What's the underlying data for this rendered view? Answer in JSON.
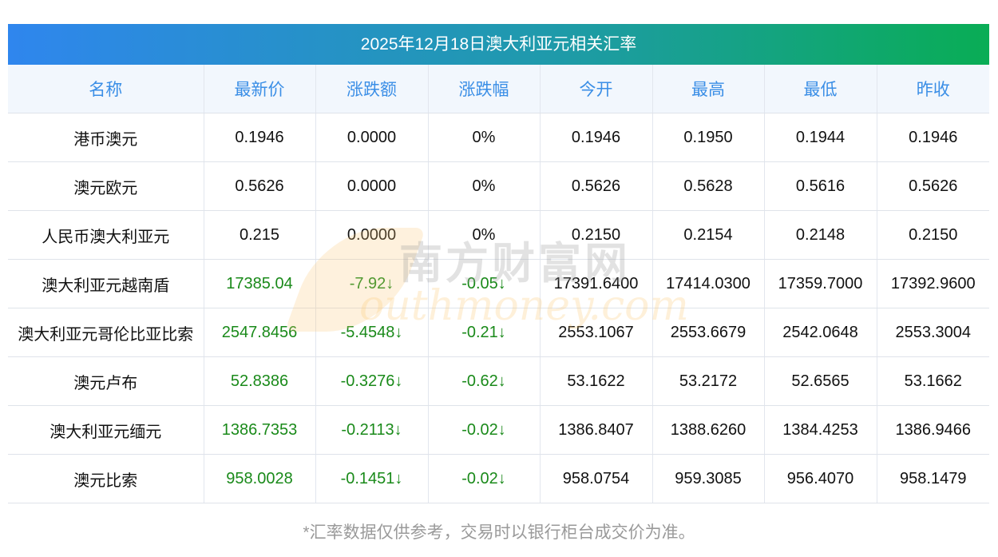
{
  "title": "2025年12月18日澳大利亚元相关汇率",
  "columns": [
    "名称",
    "最新价",
    "涨跌额",
    "涨跌幅",
    "今开",
    "最高",
    "最低",
    "昨收"
  ],
  "rows": [
    {
      "name": "港币澳元",
      "latest": "0.1946",
      "change": "0.0000",
      "pct": "0%",
      "open": "0.1946",
      "high": "0.1950",
      "low": "0.1944",
      "prev": "0.1946",
      "down": false
    },
    {
      "name": "澳元欧元",
      "latest": "0.5626",
      "change": "0.0000",
      "pct": "0%",
      "open": "0.5626",
      "high": "0.5628",
      "low": "0.5616",
      "prev": "0.5626",
      "down": false
    },
    {
      "name": "人民币澳大利亚元",
      "latest": "0.215",
      "change": "0.0000",
      "pct": "0%",
      "open": "0.2150",
      "high": "0.2154",
      "low": "0.2148",
      "prev": "0.2150",
      "down": false
    },
    {
      "name": "澳大利亚元越南盾",
      "latest": "17385.04",
      "change": "-7.92↓",
      "pct": "-0.05↓",
      "open": "17391.6400",
      "high": "17414.0300",
      "low": "17359.7000",
      "prev": "17392.9600",
      "down": true
    },
    {
      "name": "澳大利亚元哥伦比亚比索",
      "latest": "2547.8456",
      "change": "-5.4548↓",
      "pct": "-0.21↓",
      "open": "2553.1067",
      "high": "2553.6679",
      "low": "2542.0648",
      "prev": "2553.3004",
      "down": true
    },
    {
      "name": "澳元卢布",
      "latest": "52.8386",
      "change": "-0.3276↓",
      "pct": "-0.62↓",
      "open": "53.1622",
      "high": "53.2172",
      "low": "52.6565",
      "prev": "53.1662",
      "down": true
    },
    {
      "name": "澳大利亚元缅元",
      "latest": "1386.7353",
      "change": "-0.2113↓",
      "pct": "-0.02↓",
      "open": "1386.8407",
      "high": "1388.6260",
      "low": "1384.4253",
      "prev": "1386.9466",
      "down": true
    },
    {
      "name": "澳元比索",
      "latest": "958.0028",
      "change": "-0.1451↓",
      "pct": "-0.02↓",
      "open": "958.0754",
      "high": "959.3085",
      "low": "956.4070",
      "prev": "958.1479",
      "down": true
    }
  ],
  "footer": "*汇率数据仅供参考，交易时以银行柜台成交价为准。",
  "watermark": {
    "cn": "南方财富网",
    "en": "outhmoney.com"
  },
  "colors": {
    "header_text": "#3a8ee6",
    "down": "#1a8a1a",
    "gradient_start": "#2f86ee",
    "gradient_end": "#09ad55"
  }
}
